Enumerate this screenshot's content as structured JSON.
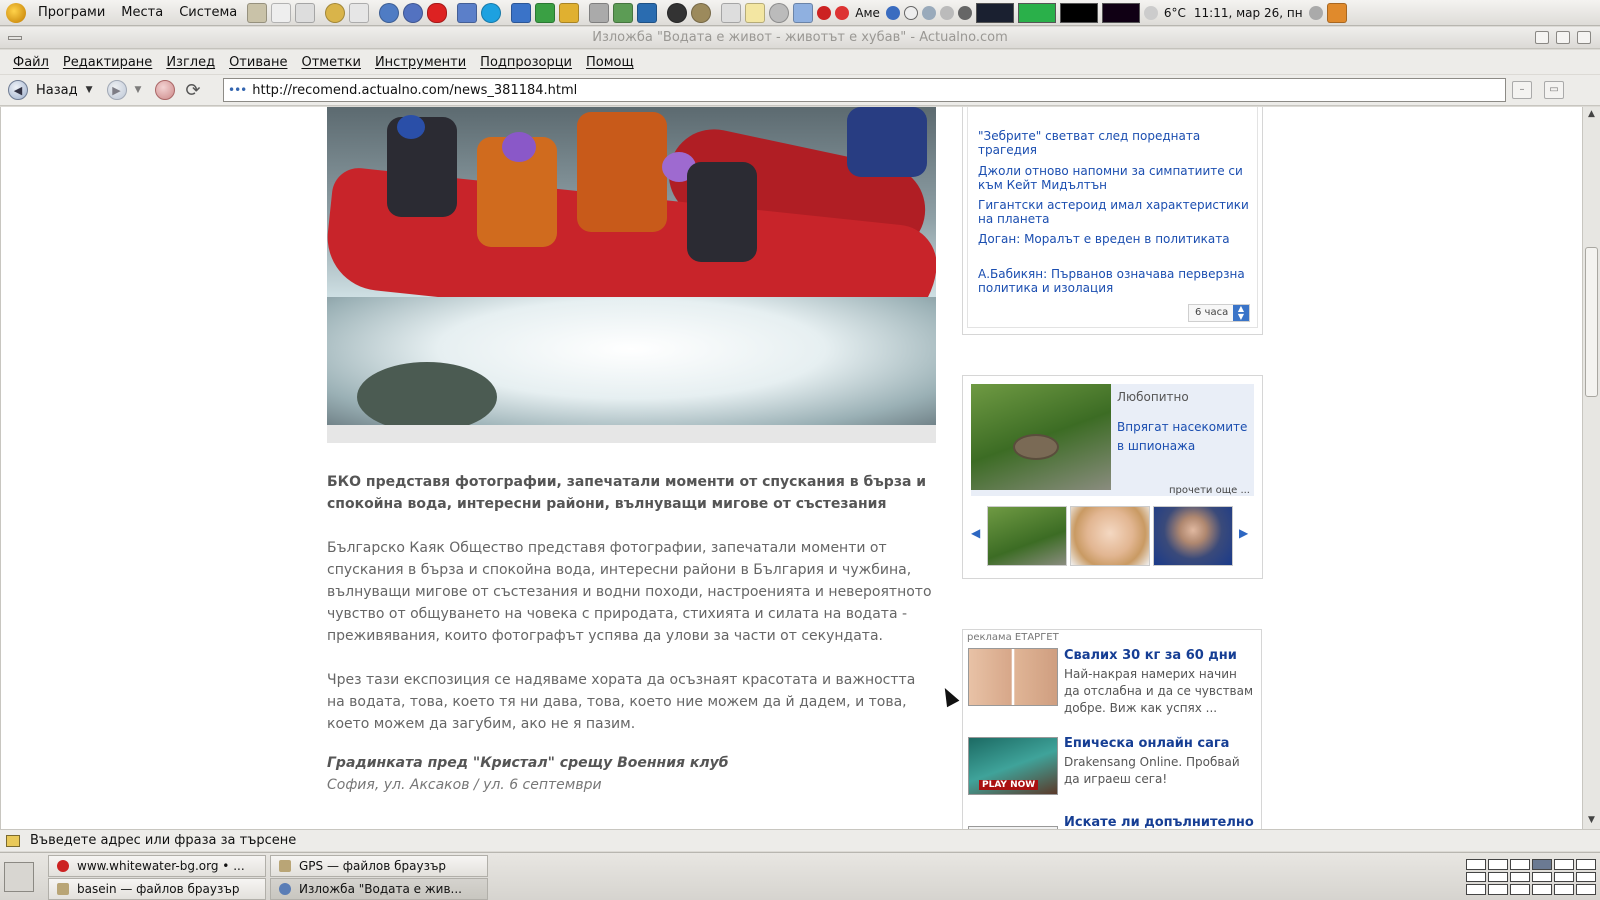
{
  "top_panel": {
    "menus": [
      "Програми",
      "Места",
      "Система"
    ],
    "weather": "6°C",
    "clock": "11:11, мар 26, пн",
    "keyboard_layout": "Аме"
  },
  "window": {
    "title": "Изложба \"Водата е живот - животът е хубав\" - Actualno.com"
  },
  "menubar": {
    "items": [
      "Файл",
      "Редактиране",
      "Изглед",
      "Отиване",
      "Отметки",
      "Инструменти",
      "Подпрозорци",
      "Помощ"
    ]
  },
  "navbar": {
    "back_label": "Назад",
    "url": "http://recomend.actualno.com/news_381184.html"
  },
  "article": {
    "lead": "БКО представя фотографии, запечатали моменти от спускания в бърза и спокойна вода, интересни райони, вълнуващи мигове от състезания",
    "paragraph1": "Българско Каяк Общество представя фотографии, запечатали моменти от спускания в бърза и спокойна вода, интересни райони в България и чужбина, вълнуващи мигове от състезания и водни походи, настроенията и невероятното чувство от общуването на човека с природата, стихията и силата на водата - преживявания, които фотографът успява да улови за части от секундата.",
    "paragraph2": "Чрез тази експозиция се надяваме хората да осъзнаят красотата и важността на водата, това, което тя ни дава, това, което ние можем да й дадем, и това, което можем да загубим, ако не я пазим.",
    "event_title": "Градинката пред \"Кристал\" срещу Военния клуб",
    "event_place": "София, ул. Аксаков / ул. 6 септември"
  },
  "news_box": {
    "links": [
      "\"Зебрите\" светват след поредната трагедия",
      "Джоли отново напомни за симпатиите си към Кейт Мидълтън",
      "Гигантски астероид имал характеристики на планета",
      "Доган: Моралът е вреден в политиката",
      "А.Бабикян: Първанов означава перверзна политика и изолация"
    ],
    "period": "6 часа"
  },
  "curious_box": {
    "label": "Любопитно",
    "link": "Впрягат насекомите в шпионажа",
    "more": "прочети още ..."
  },
  "ads": {
    "label": "реклама ЕТАРГЕТ",
    "items": [
      {
        "title": "Свалих 30 кг за 60 дни",
        "text": "Най-накрая намерих начин да отслабна и да се чувствам добре. Виж как успях ..."
      },
      {
        "title": "Епическа онлайн сага",
        "text": "Drakensang Online. Пробвай да играеш сега!"
      },
      {
        "title": "Искате ли допълнително",
        "text": ""
      }
    ],
    "play_now": "PLAY NOW"
  },
  "statusbar": {
    "text": "Въведете адрес или фраза за търсене"
  },
  "taskbar": {
    "tasks": [
      "www.whitewater-bg.org • ...",
      "GPS — файлов браузър",
      "basein — файлов браузър",
      "Изложба \"Водата е жив..."
    ]
  },
  "colors": {
    "link_blue": "#1b4eb0",
    "ad_title_blue": "#163e94",
    "raft_red": "#c8242a"
  }
}
